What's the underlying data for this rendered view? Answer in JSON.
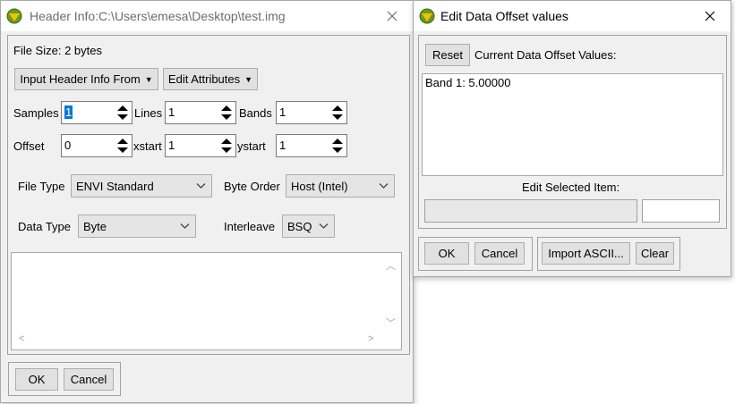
{
  "header_window": {
    "title": "Header Info:C:\\Users\\emesa\\Desktop\\test.img",
    "file_size": "File Size: 2 bytes",
    "input_header_btn": "Input Header Info From",
    "edit_attributes_btn": "Edit Attributes",
    "samples_label": "Samples",
    "samples_value": "1",
    "lines_label": "Lines",
    "lines_value": "1",
    "bands_label": "Bands",
    "bands_value": "1",
    "offset_label": "Offset",
    "offset_value": "0",
    "xstart_label": "xstart",
    "xstart_value": "1",
    "ystart_label": "ystart",
    "ystart_value": "1",
    "file_type_label": "File Type",
    "file_type_value": "ENVI Standard",
    "byte_order_label": "Byte Order",
    "byte_order_value": "Host (Intel)",
    "data_type_label": "Data Type",
    "data_type_value": "Byte",
    "interleave_label": "Interleave",
    "interleave_value": "BSQ",
    "description_text": "",
    "ok_btn": "OK",
    "cancel_btn": "Cancel"
  },
  "offset_window": {
    "title": "Edit Data Offset values",
    "reset_btn": "Reset",
    "current_label": "Current Data Offset Values:",
    "list_items": [
      "Band 1: 5.00000"
    ],
    "edit_selected_label": "Edit Selected Item:",
    "edit_value": "",
    "ok_btn": "OK",
    "cancel_btn": "Cancel",
    "import_btn": "Import ASCII...",
    "clear_btn": "Clear"
  }
}
